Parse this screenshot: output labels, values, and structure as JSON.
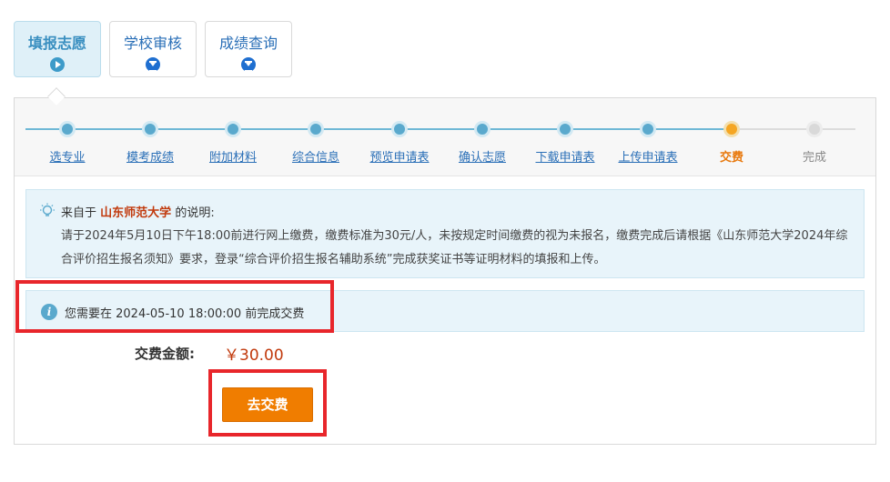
{
  "tabs": [
    {
      "label": "填报志愿",
      "icon": "play-icon",
      "active": true
    },
    {
      "label": "学校审核",
      "icon": "hourglass-icon",
      "active": false
    },
    {
      "label": "成绩查询",
      "icon": "hourglass-icon",
      "active": false
    }
  ],
  "steps": [
    {
      "label": "选专业",
      "state": "done"
    },
    {
      "label": "模考成绩",
      "state": "done"
    },
    {
      "label": "附加材料",
      "state": "done"
    },
    {
      "label": "综合信息",
      "state": "done"
    },
    {
      "label": "预览申请表",
      "state": "done"
    },
    {
      "label": "确认志愿",
      "state": "done"
    },
    {
      "label": "下载申请表",
      "state": "done"
    },
    {
      "label": "上传申请表",
      "state": "done"
    },
    {
      "label": "交费",
      "state": "current"
    },
    {
      "label": "完成",
      "state": "pending"
    }
  ],
  "note": {
    "prefix": "来自于",
    "school": "山东师范大学",
    "suffix": "的说明:",
    "body": "请于2024年5月10日下午18:00前进行网上缴费，缴费标准为30元/人，未按规定时间缴费的视为未报名，缴费完成后请根据《山东师范大学2024年综合评价招生报名须知》要求，登录“综合评价招生报名辅助系统”完成获奖证书等证明材料的填报和上传。"
  },
  "deadline": {
    "text": "您需要在 2024-05-10 18:00:00 前完成交费"
  },
  "payment": {
    "amount_label": "交费金额:",
    "amount_value": "￥30.00",
    "button_label": "去交费"
  },
  "colors": {
    "accent": "#5aa9cd",
    "current_step": "#f5a623",
    "pay_button": "#f07d00",
    "highlight_box": "#e8262b"
  }
}
